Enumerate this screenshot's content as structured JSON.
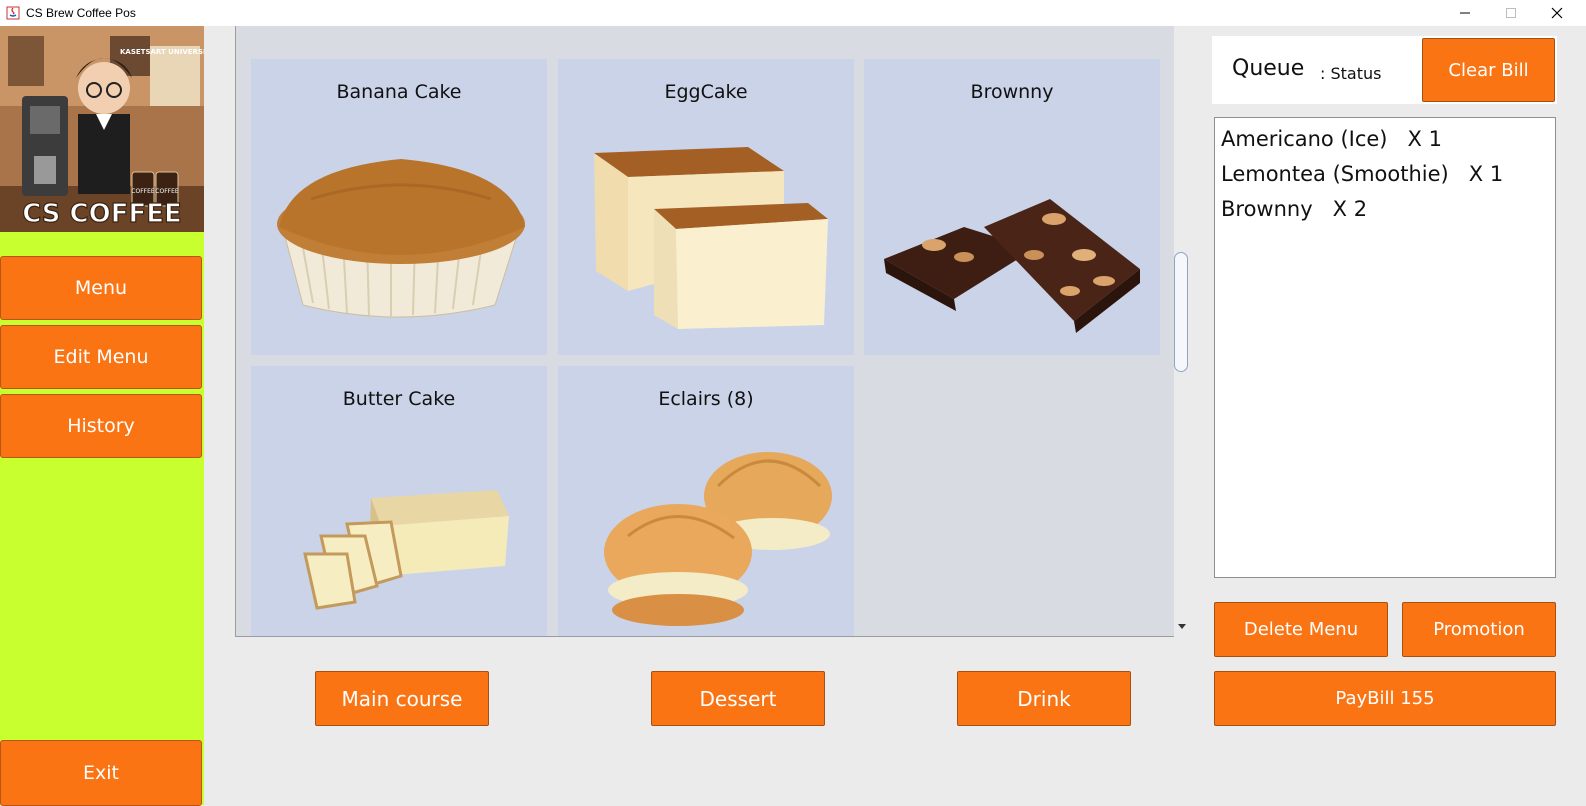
{
  "window": {
    "title": "CS Brew Coffee Pos"
  },
  "logo": {
    "brand_text": "CS COFFEE",
    "university_text": "KASETSART UNIVERSITY",
    "jar_label": "COFFEE"
  },
  "sidebar": {
    "menu": "Menu",
    "edit_menu": "Edit Menu",
    "history": "History",
    "exit": "Exit"
  },
  "products": [
    {
      "name": "Banana Cake",
      "image": "banana-cake-image"
    },
    {
      "name": "EggCake",
      "image": "egg-cake-image"
    },
    {
      "name": "Brownny",
      "image": "brownie-image"
    },
    {
      "name": "Butter Cake",
      "image": "butter-cake-image"
    },
    {
      "name": "Eclairs (8)",
      "image": "eclairs-image"
    }
  ],
  "categories": {
    "main_course": "Main course",
    "dessert": "Dessert",
    "drink": "Drink"
  },
  "queue": {
    "label": "Queue",
    "status": ": Status",
    "clear_bill": "Clear Bill"
  },
  "orders": [
    {
      "text": "Americano (Ice)   X 1"
    },
    {
      "text": "Lemontea (Smoothie)   X 1"
    },
    {
      "text": "Brownny   X 2"
    }
  ],
  "actions": {
    "delete_menu": "Delete Menu",
    "promotion": "Promotion",
    "paybill": "PayBill 155"
  },
  "colors": {
    "accent": "#fa7414",
    "sidebar_bg": "#c8ff2e",
    "card_bg": "#cad3e8"
  }
}
